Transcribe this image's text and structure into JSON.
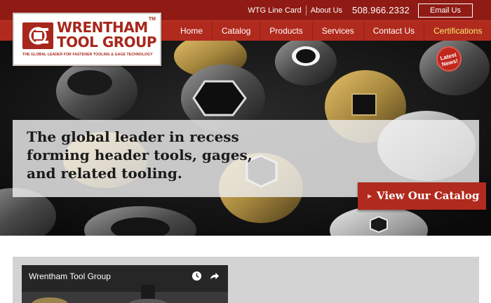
{
  "utility_nav": {
    "line_card": "WTG Line Card",
    "about": "About Us",
    "phone": "508.966.2332",
    "email_button": "Email Us"
  },
  "main_nav": {
    "items": [
      "Home",
      "Catalog",
      "Products",
      "Services",
      "Contact Us",
      "Certifications"
    ]
  },
  "logo": {
    "line1": "WRENTHAM",
    "line2": "TOOL GROUP",
    "tm": "TM",
    "tagline": "THE GLOBAL LEADER FOR FASTENER TOOLING & GAGE TECHNOLOGY"
  },
  "hero": {
    "headline": "The global leader in recess forming header tools, gages, and related tooling.",
    "catalog_button": "View Our Catalog",
    "news_badge_line1": "Latest",
    "news_badge_line2": "News!"
  },
  "video": {
    "title": "Wrentham Tool Group"
  },
  "colors": {
    "top_bar": "#8f1b14",
    "nav_bar": "#b12a1e",
    "nav_highlight": "#f7e86b",
    "brand_red": "#a8271c",
    "panel_gray": "#d3d3d3"
  }
}
